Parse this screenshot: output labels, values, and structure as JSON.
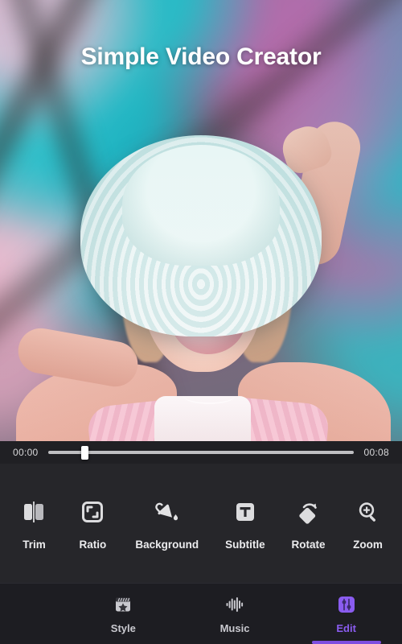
{
  "app": {
    "title": "Simple Video Creator",
    "accent_color": "#8a5cf0",
    "indicator_color": "#7d4fe0",
    "toolbar_bg": "#26262a",
    "navbar_bg": "#1d1d22"
  },
  "preview": {
    "description": "Woman in a white sun hat blowing a pink bubblegum bubble against a blurred teal and pink floral background"
  },
  "timeline": {
    "current_time": "00:00",
    "total_time": "00:08",
    "progress_percent": 12,
    "thumb_icon": "scrubber-handle"
  },
  "toolbar": {
    "items": [
      {
        "id": "trim",
        "label": "Trim",
        "icon": "trim-icon"
      },
      {
        "id": "ratio",
        "label": "Ratio",
        "icon": "ratio-icon"
      },
      {
        "id": "background",
        "label": "Background",
        "icon": "paint-bucket-icon"
      },
      {
        "id": "subtitle",
        "label": "Subtitle",
        "icon": "subtitle-text-icon"
      },
      {
        "id": "rotate",
        "label": "Rotate",
        "icon": "rotate-icon"
      },
      {
        "id": "zoom",
        "label": "Zoom",
        "icon": "zoom-in-icon"
      }
    ]
  },
  "navbar": {
    "items": [
      {
        "id": "style",
        "label": "Style",
        "icon": "clapperboard-star-icon",
        "active": false
      },
      {
        "id": "music",
        "label": "Music",
        "icon": "waveform-icon",
        "active": false
      },
      {
        "id": "edit",
        "label": "Edit",
        "icon": "sliders-icon",
        "active": true
      }
    ]
  }
}
